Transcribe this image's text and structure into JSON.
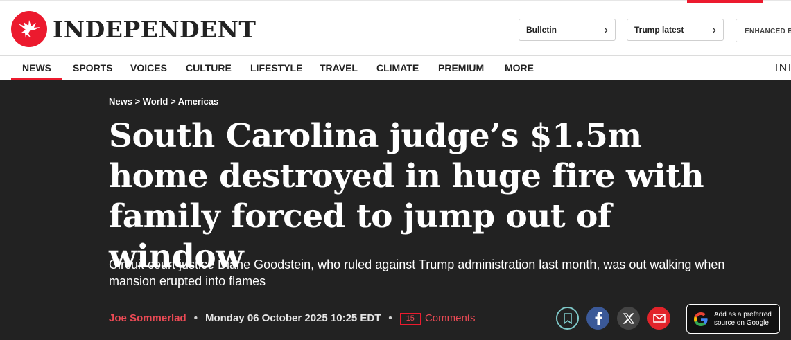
{
  "site": {
    "logo_text": "INDEPENDENT"
  },
  "header": {
    "bulletin_label": "Bulletin",
    "trump_label": "Trump latest",
    "enhanced_label": "ENHANCED BY"
  },
  "nav": {
    "items": [
      {
        "label": "NEWS"
      },
      {
        "label": "SPORTS"
      },
      {
        "label": "VOICES"
      },
      {
        "label": "CULTURE"
      },
      {
        "label": "LIFESTYLE"
      },
      {
        "label": "TRAVEL"
      },
      {
        "label": "CLIMATE"
      },
      {
        "label": "PREMIUM"
      },
      {
        "label": "MORE"
      }
    ],
    "right_text": "IND"
  },
  "article": {
    "breadcrumb": "News > World > Americas",
    "headline": "South Carolina judge’s $1.5m home destroyed in huge fire with family forced to jump out of window",
    "standfirst": "Circuit court justice Diane Goodstein, who ruled against Trump administration last month, was out walking when mansion erupted into flames",
    "author": "Joe Sommerlad",
    "date": "Monday 06 October 2025 10:25 EDT",
    "separator": "•",
    "comment_count": "15",
    "comments_label": "Comments"
  },
  "share": {
    "google_label_line1": "Add as a preferred",
    "google_label_line2": "source on Google"
  },
  "colors": {
    "brand_red": "#ec1a2e",
    "dark_bg": "#222222",
    "facebook": "#3b5998",
    "x": "#444444",
    "email": "#e2232a",
    "bookmark_ring": "#7ec8c8"
  }
}
